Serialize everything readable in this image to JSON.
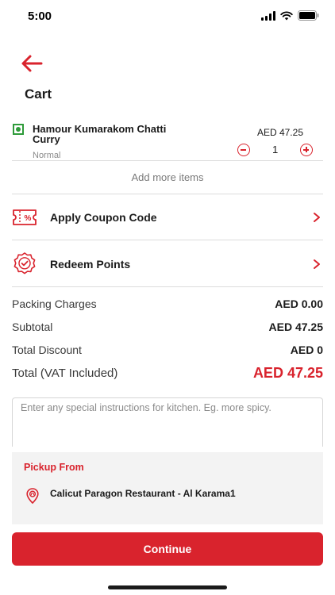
{
  "status_bar": {
    "time": "5:00"
  },
  "header": {
    "title": "Cart"
  },
  "cart": {
    "items": [
      {
        "name": "Hamour Kumarakom Chatti Curry",
        "variant": "Normal",
        "price": "AED 47.25",
        "quantity": "1"
      }
    ],
    "add_more_label": "Add more items"
  },
  "options": {
    "coupon_label": "Apply Coupon Code",
    "points_label": "Redeem Points"
  },
  "summary": {
    "packing_label": "Packing Charges",
    "packing_value": "AED 0.00",
    "subtotal_label": "Subtotal",
    "subtotal_value": "AED 47.25",
    "discount_label": "Total Discount",
    "discount_value": "AED 0",
    "total_label": "Total (VAT Included)",
    "total_value": "AED 47.25"
  },
  "instructions": {
    "placeholder": "Enter any special instructions for kitchen. Eg. more spicy."
  },
  "pickup": {
    "title": "Pickup From",
    "restaurant": "Calicut Paragon Restaurant - Al Karama1"
  },
  "actions": {
    "continue_label": "Continue"
  },
  "colors": {
    "accent": "#d9232d",
    "veg": "#2e9b3a",
    "divider": "#dcdcdc",
    "pickup_bg": "#f3f3f3"
  },
  "icons": {
    "back": "arrow-left-icon",
    "veg": "veg-indicator-icon",
    "coupon": "coupon-ticket-icon",
    "points": "badge-check-icon",
    "chevron": "chevron-right-icon",
    "pickup": "location-pin-icon"
  }
}
